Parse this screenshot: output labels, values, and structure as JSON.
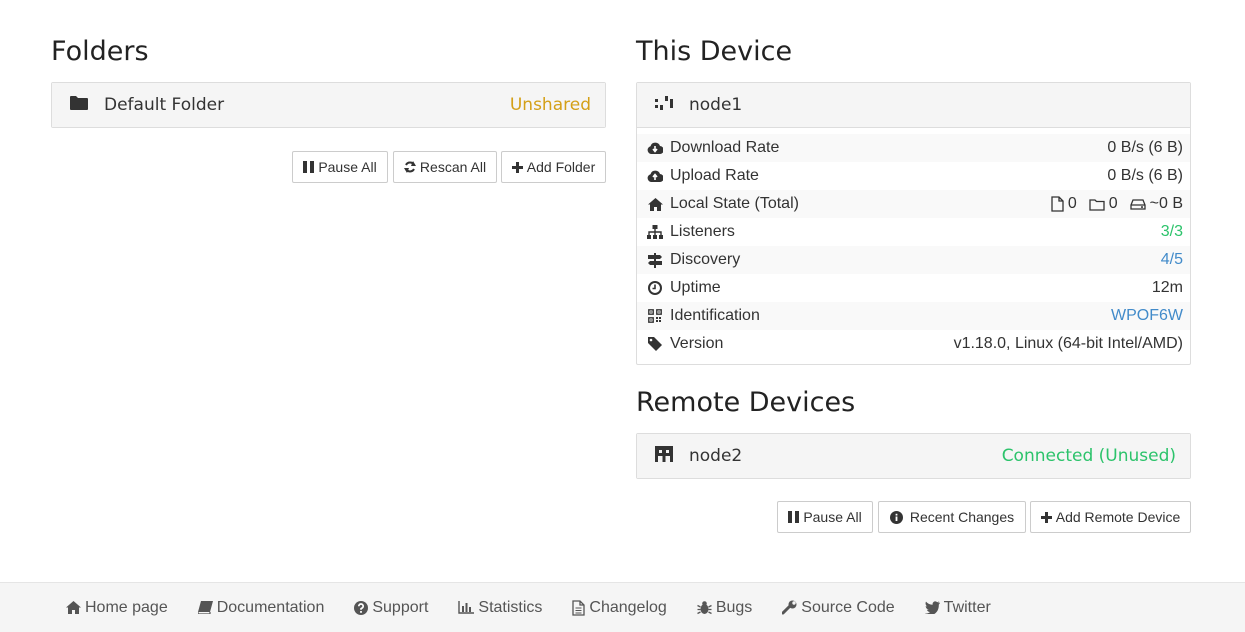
{
  "folders": {
    "title": "Folders",
    "items": [
      {
        "label": "Default Folder",
        "status": "Unshared"
      }
    ],
    "buttons": {
      "pause_all": "Pause All",
      "rescan_all": "Rescan All",
      "add_folder": "Add Folder"
    }
  },
  "this_device": {
    "title": "This Device",
    "name": "node1",
    "rows": {
      "download_rate": {
        "label": "Download Rate",
        "value": "0 B/s (6 B)"
      },
      "upload_rate": {
        "label": "Upload Rate",
        "value": "0 B/s (6 B)"
      },
      "local_state": {
        "label": "Local State (Total)",
        "files": "0",
        "dirs": "0",
        "size": "~0 B"
      },
      "listeners": {
        "label": "Listeners",
        "value": "3/3"
      },
      "discovery": {
        "label": "Discovery",
        "value": "4/5"
      },
      "uptime": {
        "label": "Uptime",
        "value": "12m"
      },
      "identification": {
        "label": "Identification",
        "value": "WPOF6W"
      },
      "version": {
        "label": "Version",
        "value": "v1.18.0, Linux (64-bit Intel/AMD)"
      }
    }
  },
  "remote_devices": {
    "title": "Remote Devices",
    "items": [
      {
        "name": "node2",
        "status": "Connected (Unused)"
      }
    ],
    "buttons": {
      "pause_all": "Pause All",
      "recent_changes": "Recent Changes",
      "add_remote": "Add Remote Device"
    }
  },
  "footer": {
    "links": [
      "Home page",
      "Documentation",
      "Support",
      "Statistics",
      "Changelog",
      "Bugs",
      "Source Code",
      "Twitter"
    ]
  },
  "colors": {
    "unshared": "#d4a017",
    "connected": "#2cc36b",
    "link": "#428bca"
  }
}
